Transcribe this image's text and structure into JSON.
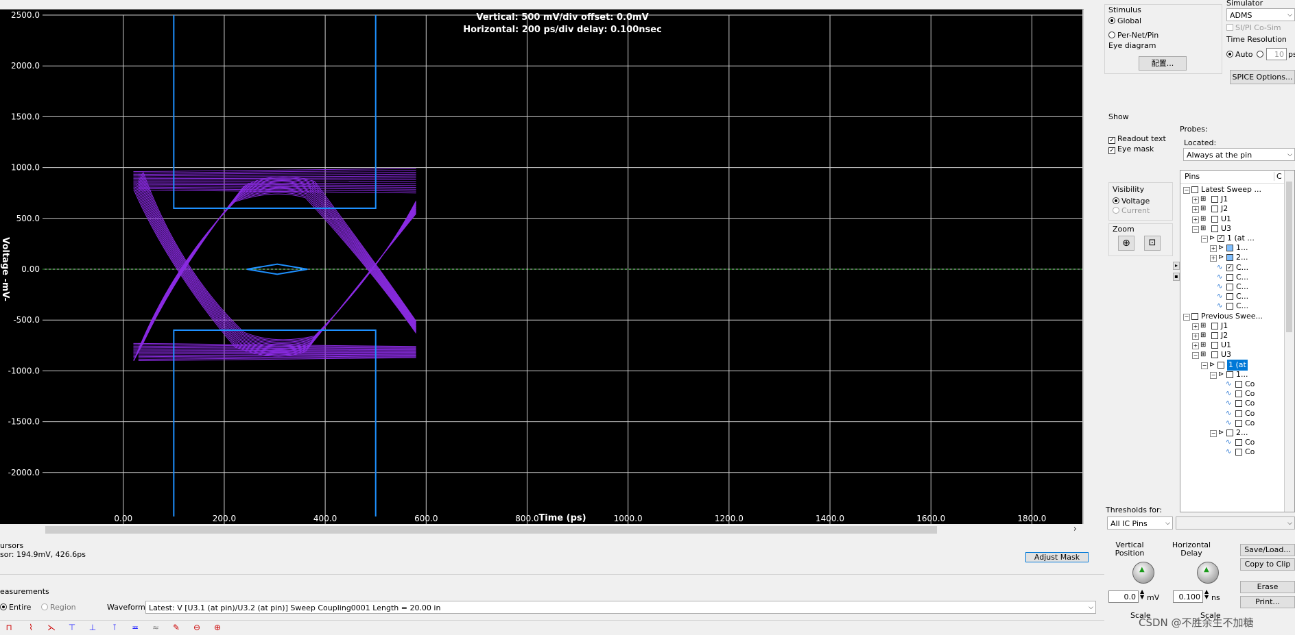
{
  "plot": {
    "header_vertical": "Vertical: 500 mV/div  offset: 0.0mV",
    "header_horizontal": "Horizontal: 200 ps/div  delay: 0.100nsec",
    "ylabel": "Voltage  -mV-",
    "xlabel": "Time  (ps)",
    "background": "#000000",
    "grid_color": "#cfcfcf",
    "eye_color": "#8a2be2",
    "mask_color": "#1e90ff"
  },
  "chart_data": {
    "type": "line",
    "title": "",
    "xlabel": "Time  (ps)",
    "ylabel": "Voltage  -mV-",
    "xlim": [
      -160,
      1900
    ],
    "ylim": [
      -2500,
      2500
    ],
    "x_ticks": [
      "0.00",
      "200.0",
      "400.0",
      "600.0",
      "800.0",
      "1000.0",
      "1200.0",
      "1400.0",
      "1600.0",
      "1800.0"
    ],
    "y_ticks": [
      "2500.0",
      "2000.0",
      "1500.0",
      "1000.0",
      "500.0",
      "0.00",
      "-500.0",
      "-1000.0",
      "-1500.0",
      "-2000.0"
    ],
    "grid": true,
    "mask": {
      "left_x": 100,
      "right_x": 500,
      "top_inner_y": 600,
      "bottom_inner_y": -600,
      "center_polygon_x": [
        245,
        305,
        365,
        305
      ],
      "center_polygon_y": [
        0,
        50,
        0,
        -50
      ]
    },
    "eye": {
      "high_level_band": [
        780,
        960
      ],
      "low_level_band": [
        -900,
        -730
      ],
      "crossing_x": [
        100,
        500
      ],
      "start_x": 20,
      "end_x": 580
    }
  },
  "readouts": {
    "cursors_title": "ursors",
    "cursor_value": "sor: 194.9mV, 426.6ps",
    "adjust_mask": "Adjust Mask",
    "measurements_title": "easurements",
    "entire": "Entire",
    "region": "Region",
    "waveform_label": "Waveform:",
    "waveform_value": "Latest: V [U3.1 (at pin)/U3.2 (at pin)] Sweep Coupling0001 Length = 20.00 in"
  },
  "right_panel": {
    "simulator_title": "Simulator",
    "simulator_value": "ADMS",
    "si_pi_cosim": "SI/PI Co-Sim",
    "time_resolution": "Time Resolution",
    "auto": "Auto",
    "time_res_value": "10",
    "time_res_unit": "ps",
    "spice_options": "SPICE Options...",
    "stimulus_title": "Stimulus",
    "global": "Global",
    "per_net_pin": "Per-Net/Pin",
    "eye_diagram": "Eye diagram",
    "config_button": "配置...",
    "show_title": "Show",
    "readout_text": "Readout text",
    "eye_mask": "Eye mask",
    "probes": "Probes:",
    "located": "Located:",
    "located_value": "Always at the pin",
    "visibility_title": "Visibility",
    "voltage": "Voltage",
    "current": "Current",
    "zoom_title": "Zoom",
    "thresholds_for": "Thresholds for:",
    "thresholds_value": "All IC Pins",
    "vertical_position": "Vertical Position",
    "horizontal_delay": "Horizontal Delay",
    "vpos_value": "0.0",
    "vpos_unit": "mV",
    "hdelay_value": "0.100",
    "hdelay_unit": "ns",
    "scale": "Scale",
    "scale2": "Scale",
    "save_load": "Save/Load...",
    "copy_to_clip": "Copy to Clip",
    "erase": "Erase",
    "print": "Print...",
    "watermark": "CSDN @不胜余生不加糖"
  },
  "tree": {
    "header_pins": "Pins",
    "header_c": "C",
    "rows": [
      {
        "text": "Latest Sweep ...",
        "indent": 0,
        "pm": "−",
        "cb": true,
        "kind": "group"
      },
      {
        "text": "J1",
        "indent": 1,
        "pm": "+",
        "kind": "chip"
      },
      {
        "text": "J2",
        "indent": 1,
        "pm": "+",
        "kind": "chip"
      },
      {
        "text": "U1",
        "indent": 1,
        "pm": "+",
        "kind": "chip"
      },
      {
        "text": "U3",
        "indent": 1,
        "pm": "−",
        "kind": "chip"
      },
      {
        "text": "1 (at ...",
        "indent": 2,
        "pm": "−",
        "kind": "probe",
        "checked": true,
        "color": "#8a2be2"
      },
      {
        "text": "1...",
        "indent": 3,
        "pm": "+",
        "kind": "pin",
        "fill": "#7fbfff",
        "color": "#1e90ff"
      },
      {
        "text": "2...",
        "indent": 3,
        "pm": "+",
        "kind": "pin",
        "fill": "#7fbfff",
        "color": "#ff8c00"
      },
      {
        "text": "C...",
        "indent": 3,
        "kind": "wave",
        "checked": true,
        "color": "#8a2be2"
      },
      {
        "text": "C...",
        "indent": 3,
        "kind": "wave",
        "color": "#8a2be2"
      },
      {
        "text": "C...",
        "indent": 3,
        "kind": "wave",
        "color": "#8a2be2"
      },
      {
        "text": "C...",
        "indent": 3,
        "kind": "wave",
        "color": "#8a2be2"
      },
      {
        "text": "C...",
        "indent": 3,
        "kind": "wave",
        "color": "#8a2be2"
      },
      {
        "text": "Previous Swee...",
        "indent": 0,
        "pm": "−",
        "cb": true,
        "kind": "group"
      },
      {
        "text": "J1",
        "indent": 1,
        "pm": "+",
        "kind": "chip"
      },
      {
        "text": "J2",
        "indent": 1,
        "pm": "+",
        "kind": "chip"
      },
      {
        "text": "U1",
        "indent": 1,
        "pm": "+",
        "kind": "chip"
      },
      {
        "text": "U3",
        "indent": 1,
        "pm": "−",
        "kind": "chip"
      },
      {
        "text": "1 (at",
        "indent": 2,
        "pm": "−",
        "kind": "probe",
        "selected": true,
        "color": "#8a2be2"
      },
      {
        "text": "1...",
        "indent": 3,
        "pm": "−",
        "kind": "pin",
        "color": "#1e90ff"
      },
      {
        "text": "Co",
        "indent": 4,
        "kind": "wave",
        "color": "#1e90ff"
      },
      {
        "text": "Co",
        "indent": 4,
        "kind": "wave",
        "color": "#1e90ff"
      },
      {
        "text": "Co",
        "indent": 4,
        "kind": "wave",
        "color": "#1e90ff"
      },
      {
        "text": "Co",
        "indent": 4,
        "kind": "wave",
        "color": "#1e90ff"
      },
      {
        "text": "Co",
        "indent": 4,
        "kind": "wave",
        "color": "#1e90ff"
      },
      {
        "text": "2...",
        "indent": 3,
        "pm": "−",
        "kind": "pin",
        "color": "#ff8c00"
      },
      {
        "text": "Co",
        "indent": 4,
        "kind": "wave",
        "color": "#ff8c00"
      },
      {
        "text": "Co",
        "indent": 4,
        "kind": "wave",
        "color": "#ff8c00"
      }
    ]
  }
}
